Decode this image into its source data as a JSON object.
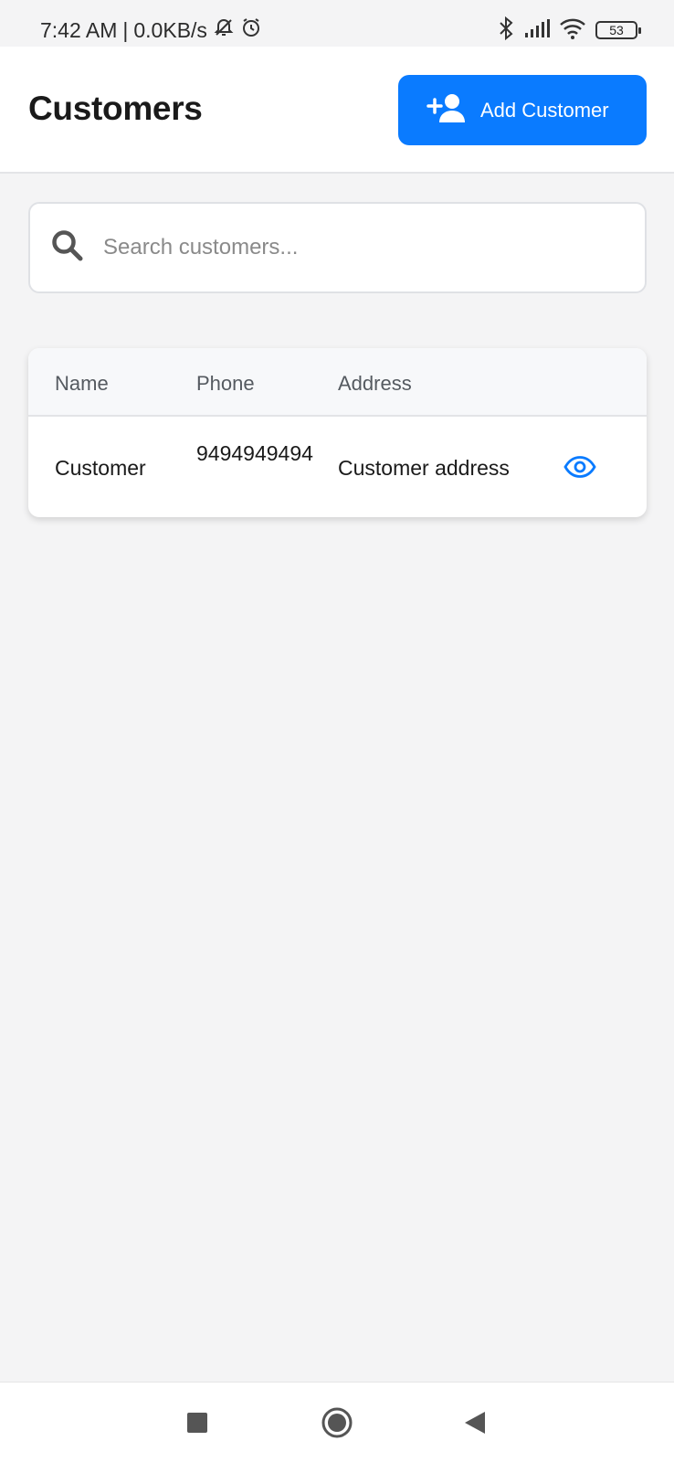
{
  "status_bar": {
    "time": "7:42 AM",
    "separator": "|",
    "network_speed": "0.0KB/s",
    "battery": "53",
    "icons": [
      "notifications-off-icon",
      "alarm-icon",
      "bluetooth-icon",
      "signal-icon",
      "wifi-icon",
      "battery-icon"
    ]
  },
  "header": {
    "title": "Customers",
    "add_button_label": "Add Customer",
    "add_button_icon": "person-add-icon",
    "accent_color": "#0a7bff"
  },
  "search": {
    "placeholder": "Search customers...",
    "value": "",
    "icon": "search-icon"
  },
  "table": {
    "columns": [
      "Name",
      "Phone",
      "Address"
    ],
    "rows": [
      {
        "name": "Customer",
        "phone": "9494949494",
        "address": "Customer address",
        "action_icon": "eye-icon"
      }
    ]
  },
  "nav_bar": {
    "icons": [
      "recent-apps-icon",
      "home-icon",
      "back-icon"
    ]
  }
}
